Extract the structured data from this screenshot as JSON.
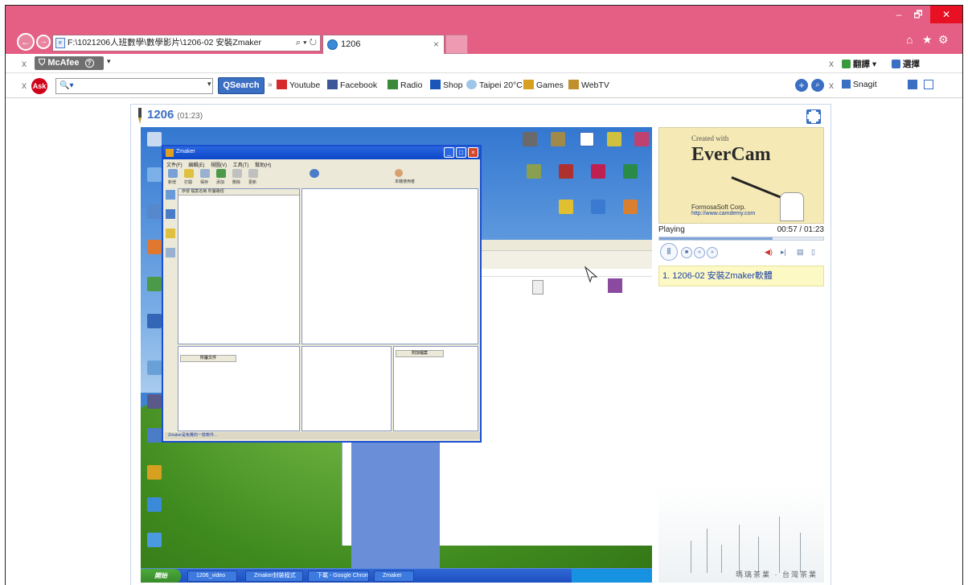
{
  "window": {
    "minimize": "–",
    "maximize": "🗗",
    "close": "✕"
  },
  "nav": {
    "back": "←",
    "forward": "→"
  },
  "address_bar": {
    "url": "F:\\1021206人班數學\\數學影片\\1206-02 安裝Zmaker",
    "tail": "⌕ ▾ ↻"
  },
  "tabs": [
    {
      "label": "1206",
      "close": "×"
    }
  ],
  "browser_icons": {
    "home": "⌂",
    "favorites": "★",
    "settings": "⚙"
  },
  "toolbar1": {
    "close_x": "x",
    "mcafee_label": "McAfee",
    "mcafee_icon": "?",
    "right_close_x": "x",
    "translate_label": "翻譯",
    "select_label": "選擇"
  },
  "toolbar2": {
    "close_x": "x",
    "ask_logo": "Ask",
    "search_placeholder": "🔍▾",
    "search_button": "Search",
    "links": [
      {
        "label": "Youtube",
        "color": "#d62a2a"
      },
      {
        "label": "Facebook",
        "color": "#3b5998"
      },
      {
        "label": "Radio",
        "color": "#3a8a3a"
      },
      {
        "label": "Shop",
        "color": "#1a55b8"
      },
      {
        "label": "Taipei 20°C",
        "color": "#9fc6e8"
      },
      {
        "label": "Games",
        "color": "#d8a020"
      },
      {
        "label": "WebTV",
        "color": "#c09030"
      }
    ],
    "right_close_x": "x",
    "snagit_label": "Snagit"
  },
  "player": {
    "title": "1206",
    "duration": "(01:23)",
    "video": {
      "zmaker_title": "Zmaker",
      "zmaker_menu": "文件(F) 編輯(E) 視圖(V) 工具(T) 幫助(H)",
      "zmaker_tools": [
        "新增",
        "打開",
        "保存",
        "添加",
        "刪除",
        "更新"
      ],
      "zmaker_pane_head": "序號  檔案名稱  所屬路徑",
      "zmaker_lower_left": "所屬文件",
      "zmaker_lower_right": "附加檔案",
      "zmaker_status": "Zmaker是免費的一款軟件…",
      "zmaker_user": "本機使用者",
      "taskbar_start": "開始",
      "taskbar_items": [
        "1206_video",
        "Zmaker封裝程式",
        "下載 - Google Chrome",
        "Zmaker"
      ]
    },
    "ad": {
      "small": "Created with",
      "big": "EverCam",
      "corp": "FormosaSoft Corp.",
      "url": "http://www.camdemy.com"
    },
    "status": "Playing",
    "time": "00:57 / 01:23",
    "progress": 0.69,
    "chapter": "1. 1206-02 安裝Zmaker軟體",
    "deco_text": "瑪璃茶業 · 台灣茶業"
  }
}
